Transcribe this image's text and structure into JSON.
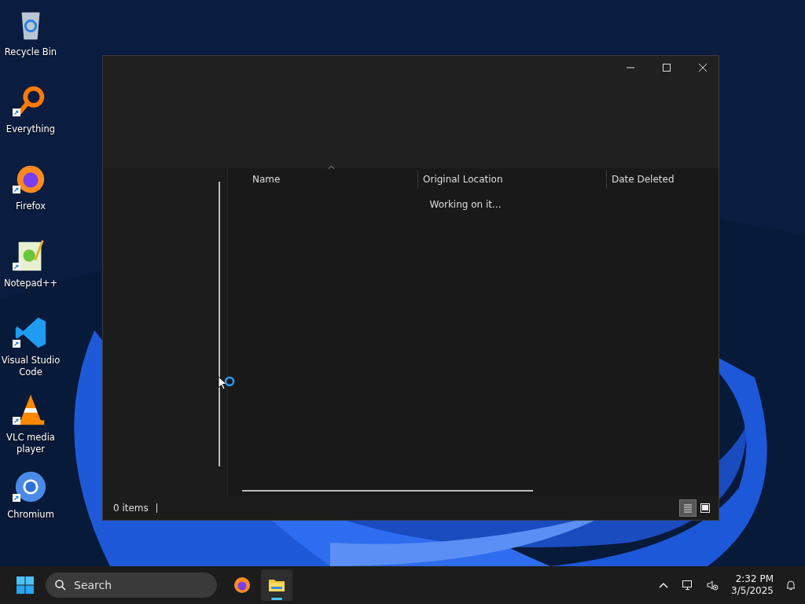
{
  "desktop_icons": [
    {
      "label": "Recycle Bin",
      "kind": "bin",
      "shortcut": false
    },
    {
      "label": "Everything",
      "kind": "everything",
      "shortcut": true
    },
    {
      "label": "Firefox",
      "kind": "firefox",
      "shortcut": true
    },
    {
      "label": "Notepad++",
      "kind": "notepad",
      "shortcut": true
    },
    {
      "label": "Visual Studio Code",
      "kind": "vscode",
      "shortcut": true
    },
    {
      "label": "VLC media player",
      "kind": "vlc",
      "shortcut": true
    },
    {
      "label": "Chromium",
      "kind": "chromium",
      "shortcut": true
    }
  ],
  "window": {
    "columns": [
      {
        "label": "Name",
        "sorted": true
      },
      {
        "label": "Original Location",
        "sorted": false
      },
      {
        "label": "Date Deleted",
        "sorted": false
      }
    ],
    "message": "Working on it...",
    "status": "0 items",
    "views": [
      {
        "kind": "details",
        "selected": true
      },
      {
        "kind": "tiles",
        "selected": false
      }
    ]
  },
  "taskbar": {
    "search": {
      "placeholder": "Search"
    },
    "apps": [
      {
        "kind": "firefox",
        "active": false
      },
      {
        "kind": "explorer",
        "active": true
      }
    ],
    "time": "2:32 PM",
    "date": "3/5/2025"
  }
}
